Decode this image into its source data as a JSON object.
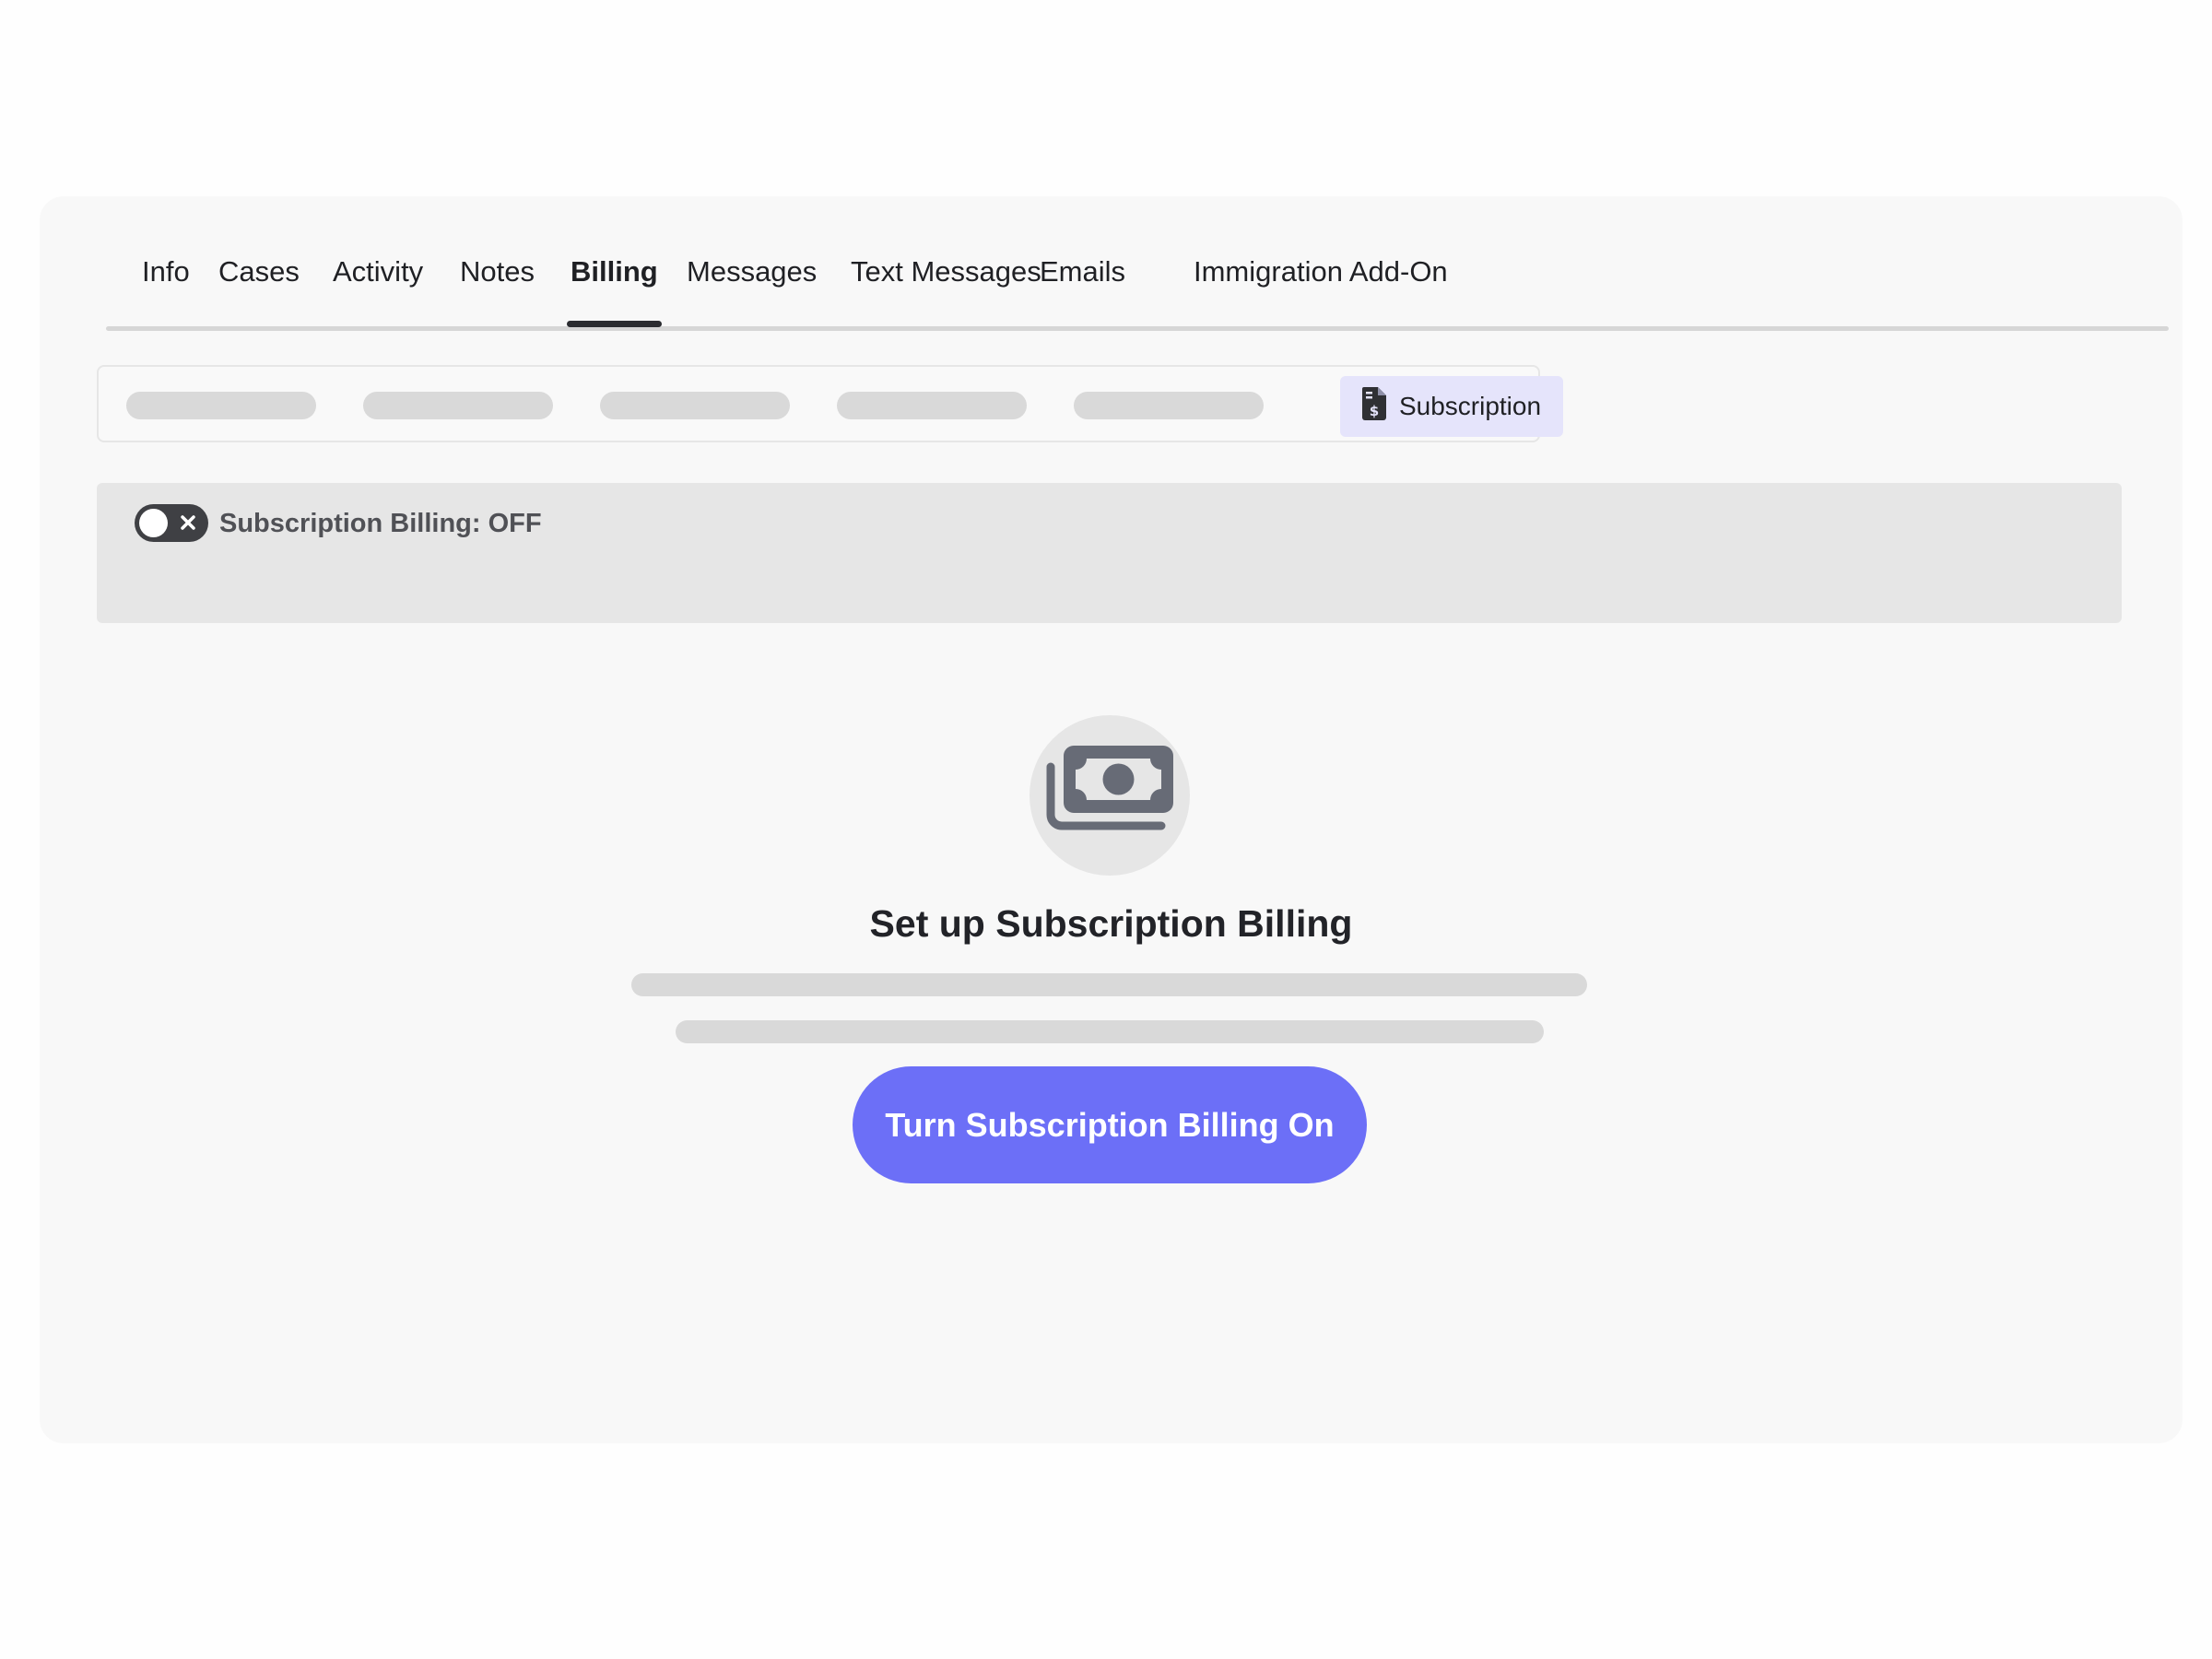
{
  "tabs": [
    {
      "label": "Info"
    },
    {
      "label": "Cases"
    },
    {
      "label": "Activity"
    },
    {
      "label": "Notes"
    },
    {
      "label": "Billing",
      "active": true
    },
    {
      "label": "Messages"
    },
    {
      "label": "Text Messages"
    },
    {
      "label": "Emails"
    },
    {
      "label": "Immigration Add-On"
    }
  ],
  "subnav": {
    "active_label": "Subscription",
    "active_icon": "invoice-dollar-icon",
    "active_bg": "#e5e4fb"
  },
  "subscription_toggle": {
    "label": "Subscription Billing: OFF",
    "state": "off",
    "icon": "close-icon"
  },
  "empty_state": {
    "icon": "money-bill-icon",
    "title": "Set up Subscription Billing",
    "button_label": "Turn Subscription Billing On",
    "button_color": "#6c6ff7"
  }
}
